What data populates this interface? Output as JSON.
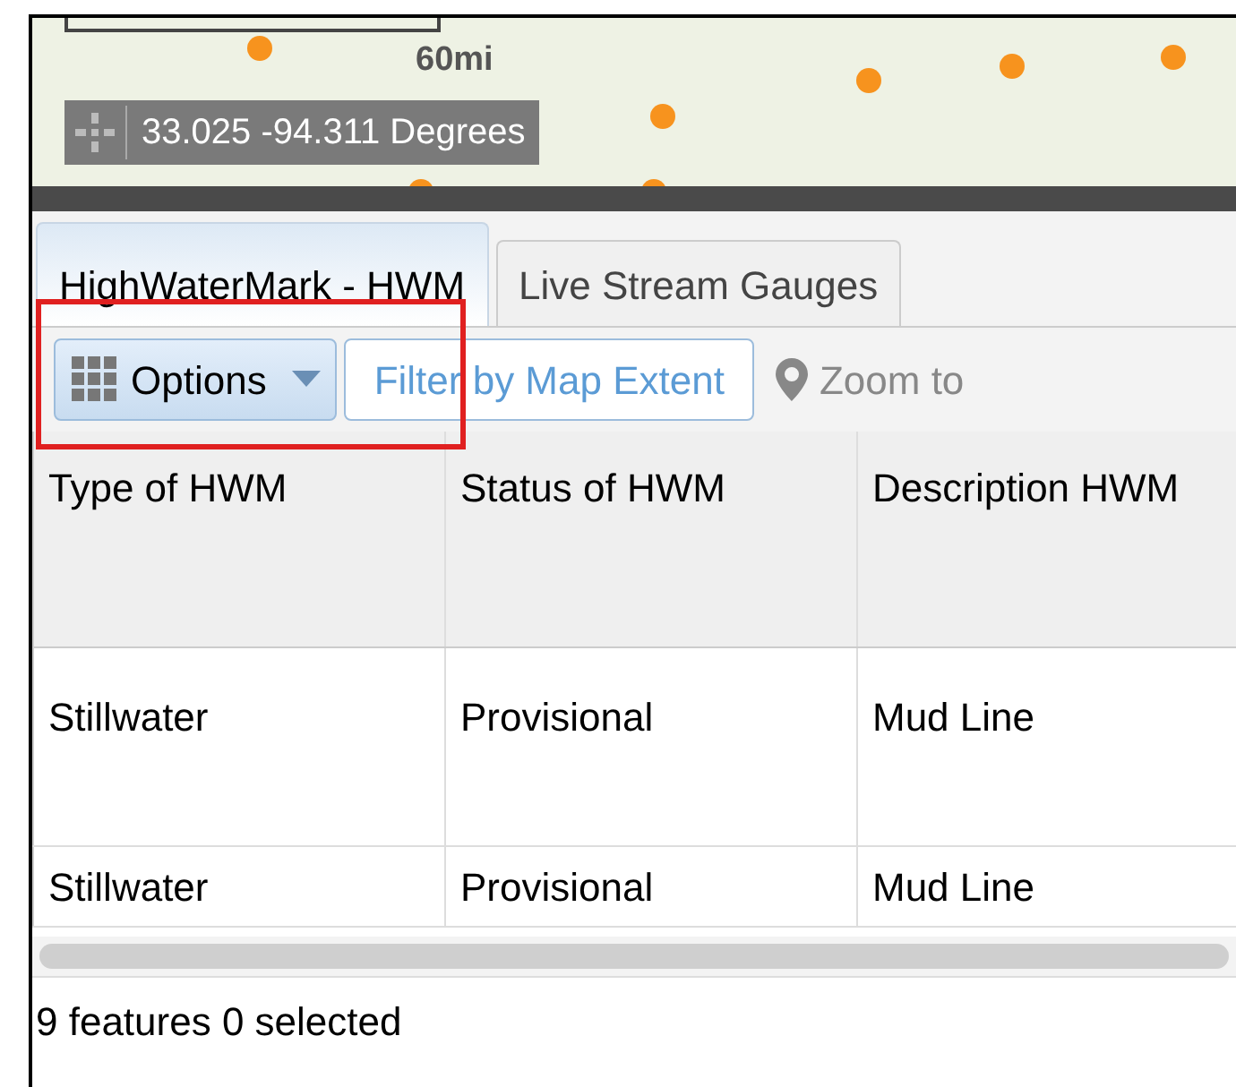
{
  "map": {
    "scale": "60mi",
    "coordinates": "33.025 -94.311 Degrees"
  },
  "tabs": [
    {
      "label": "HighWaterMark - HWM",
      "selected": true
    },
    {
      "label": "Live Stream Gauges",
      "selected": false
    }
  ],
  "toolbar": {
    "options": "Options",
    "filter": "Filter by Map Extent",
    "zoom": "Zoom to"
  },
  "table": {
    "columns": [
      "Type of HWM",
      "Status of HWM",
      "Description HWM"
    ],
    "rows": [
      [
        "Stillwater",
        "Provisional",
        "Mud Line"
      ],
      [
        "Stillwater",
        "Provisional",
        "Mud Line"
      ]
    ]
  },
  "status_bar": "9 features 0 selected"
}
